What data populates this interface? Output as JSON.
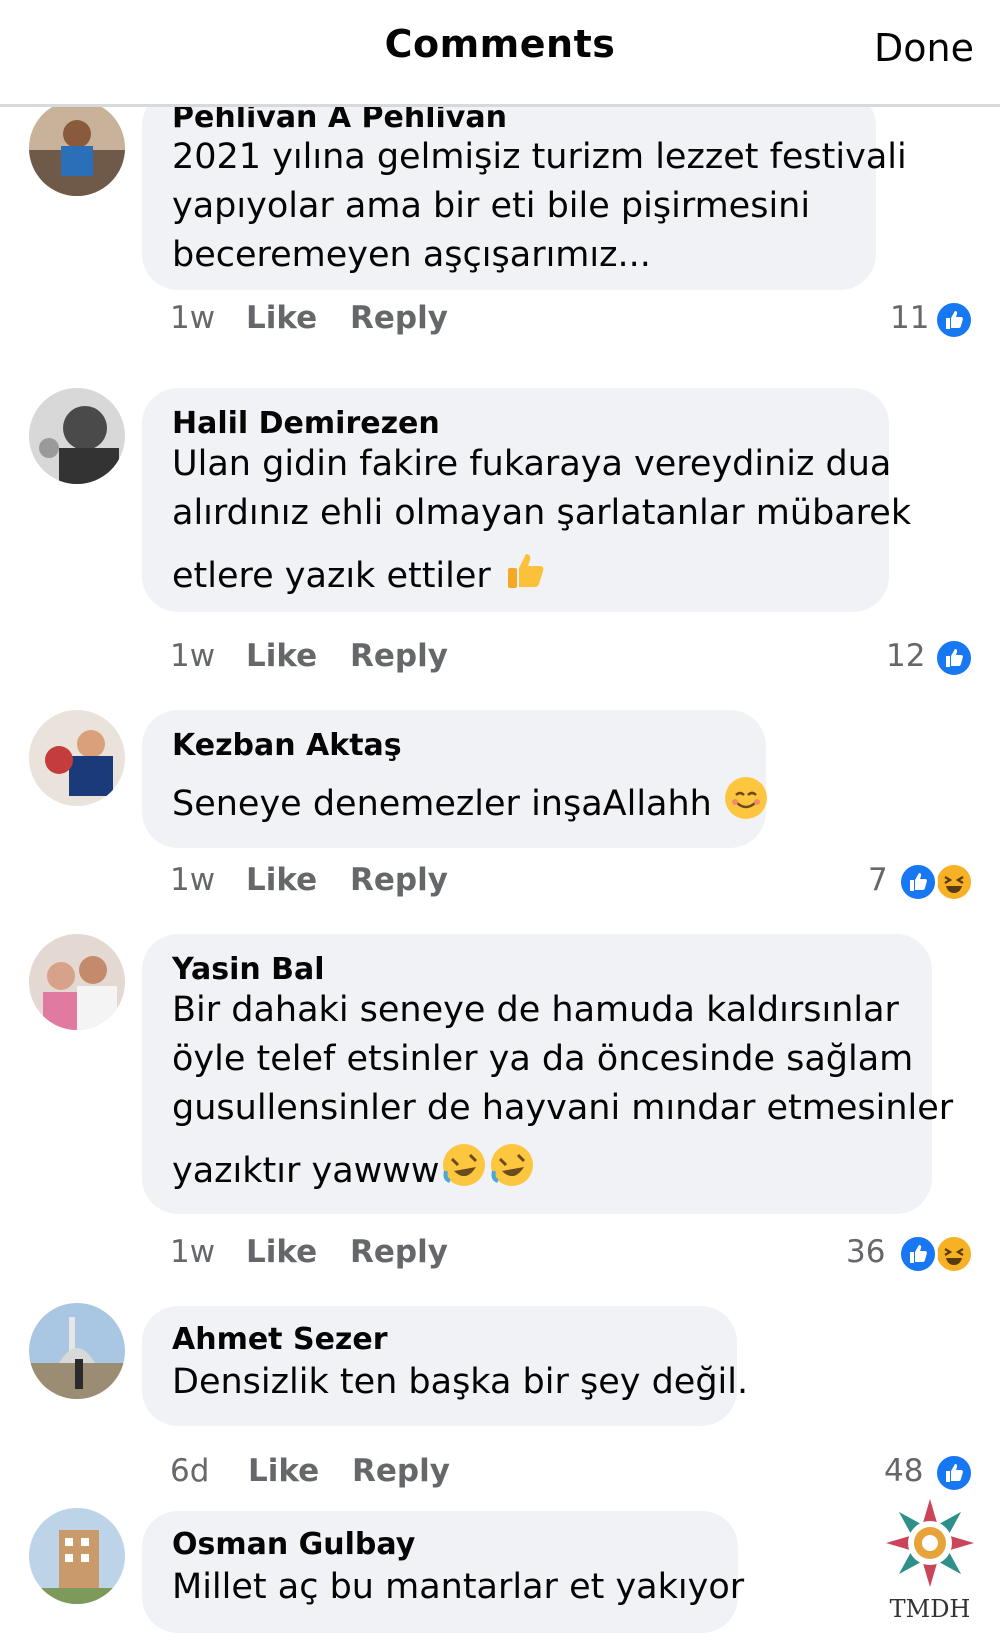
{
  "header": {
    "title": "Comments",
    "done_label": "Done"
  },
  "actions": {
    "like": "Like",
    "reply": "Reply"
  },
  "comments": [
    {
      "author": "Pehlivan A Pehlivan",
      "lines": [
        "2021 yılına gelmişiz turizm lezzet festivali",
        "yapıyolar ama bir eti bile pişirmesini",
        "beceremeyen aşçışarımız..."
      ],
      "time": "1w",
      "reaction_count": "11",
      "reactions": [
        "like-icon"
      ]
    },
    {
      "author": "Halil Demirezen",
      "lines": [
        "Ulan gidin fakire fukaraya vereydiniz dua",
        "alırdınız ehli olmayan şarlatanlar mübarek",
        "etlere yazık ettiler"
      ],
      "time": "1w",
      "reaction_count": "12",
      "reactions": [
        "like-icon"
      ]
    },
    {
      "author": "Kezban Aktaş",
      "lines": [
        "Seneye denemezler inşaAllahh"
      ],
      "time": "1w",
      "reaction_count": "7",
      "reactions": [
        "like-icon",
        "haha-icon"
      ]
    },
    {
      "author": "Yasin Bal",
      "lines": [
        "Bir dahaki seneye de hamuda kaldırsınlar",
        "öyle telef etsinler ya da öncesinde sağlam",
        "gusullensinler de hayvani mındar etmesinler",
        "yazıktır yawww"
      ],
      "time": "1w",
      "reaction_count": "36",
      "reactions": [
        "like-icon",
        "haha-icon"
      ]
    },
    {
      "author": "Ahmet Sezer",
      "lines": [
        "Densizlik ten başka bir şey değil."
      ],
      "time": "6d",
      "reaction_count": "48",
      "reactions": [
        "like-icon"
      ]
    },
    {
      "author": "Osman Gulbay",
      "lines": [
        "Millet aç bu mantarlar et yakıyor"
      ],
      "time": "",
      "reaction_count": "",
      "reactions": []
    }
  ],
  "watermark": {
    "text": "TMDH"
  },
  "colors": {
    "bubble": "#f0f2f5",
    "like_blue": "#1877f2",
    "haha_yellow": "#f7b125",
    "meta_gray": "#65676b"
  }
}
